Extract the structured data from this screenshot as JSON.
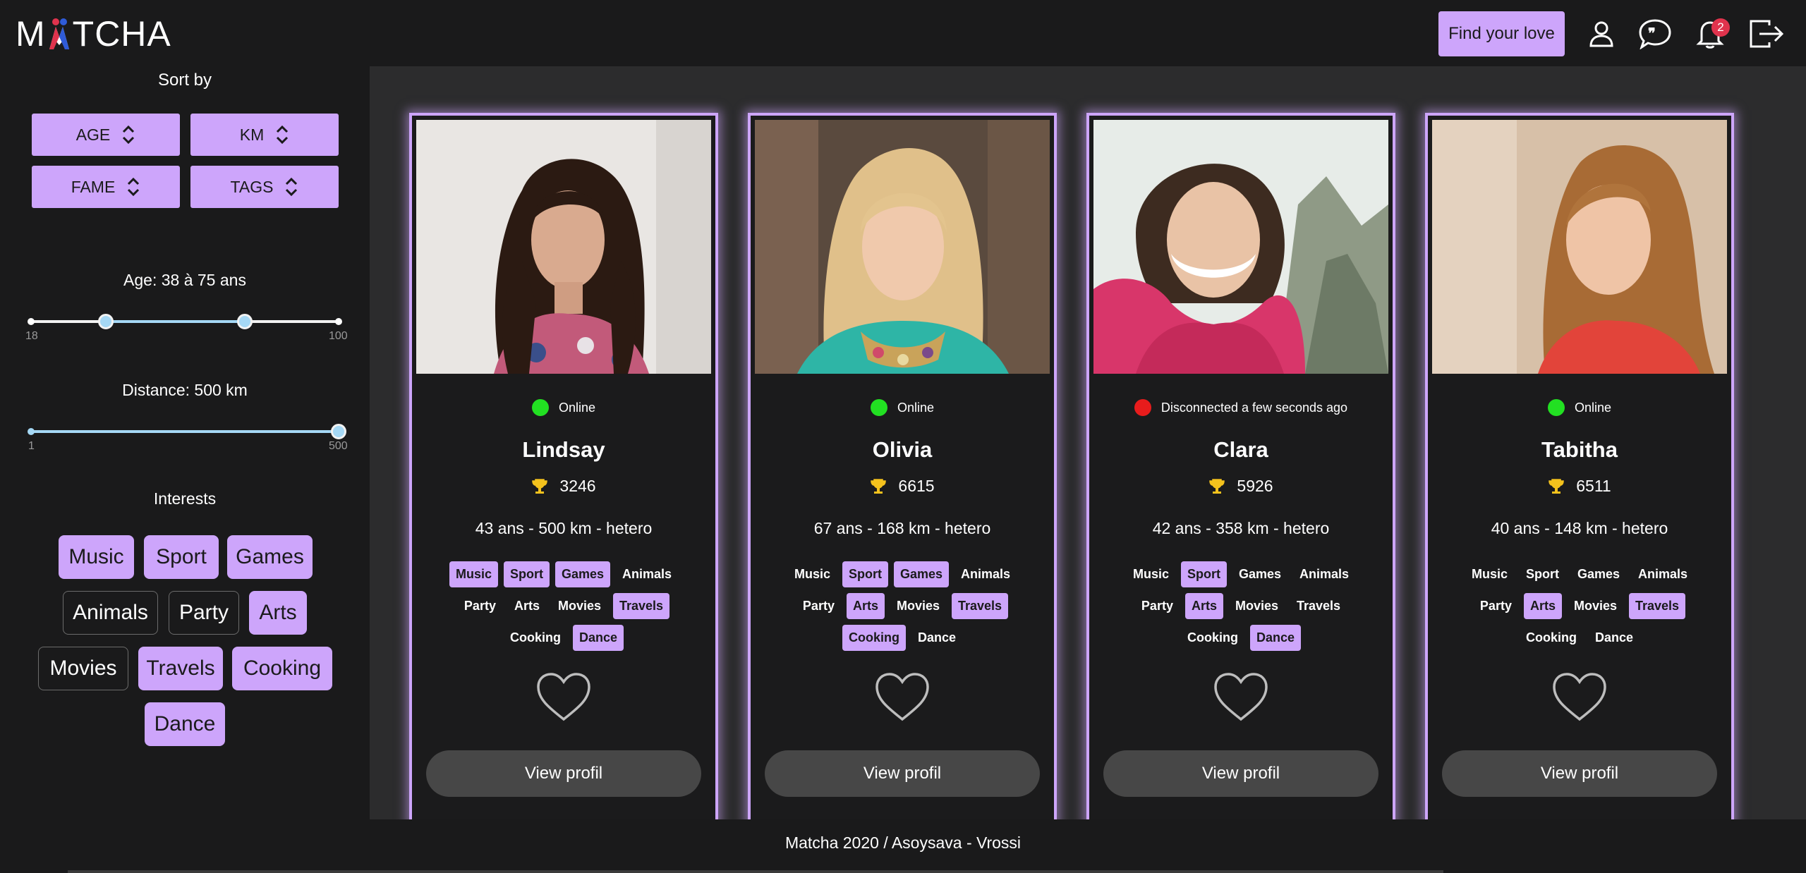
{
  "header": {
    "logo": "MATCHA",
    "find_love_label": "Find your love",
    "notification_count": "2",
    "icons": [
      "user-icon",
      "chat-icon",
      "bell-icon",
      "logout-icon"
    ]
  },
  "sidebar": {
    "sort_title": "Sort by",
    "sort_buttons": [
      "AGE",
      "KM",
      "FAME",
      "TAGS"
    ],
    "age": {
      "label": "Age: 38 à 75 ans",
      "min_label": "18",
      "max_label": "100",
      "min": 18,
      "max": 100,
      "low": 38,
      "high": 75
    },
    "distance": {
      "label": "Distance: 500 km",
      "min_label": "1",
      "max_label": "500",
      "min": 1,
      "max": 500,
      "value": 500
    },
    "interests_title": "Interests",
    "interests": [
      {
        "label": "Music",
        "selected": true
      },
      {
        "label": "Sport",
        "selected": true
      },
      {
        "label": "Games",
        "selected": true
      },
      {
        "label": "Animals",
        "selected": false
      },
      {
        "label": "Party",
        "selected": false
      },
      {
        "label": "Arts",
        "selected": true
      },
      {
        "label": "Movies",
        "selected": false
      },
      {
        "label": "Travels",
        "selected": true
      },
      {
        "label": "Cooking",
        "selected": true
      },
      {
        "label": "Dance",
        "selected": true
      }
    ]
  },
  "cards": [
    {
      "status": "Online",
      "online": true,
      "name": "Lindsay",
      "fame": "3246",
      "meta": "43 ans - 500 km - hetero",
      "tags": [
        [
          "Music",
          true
        ],
        [
          "Sport",
          true
        ],
        [
          "Games",
          true
        ],
        [
          "Animals",
          false
        ],
        [
          "Party",
          false
        ],
        [
          "Arts",
          false
        ],
        [
          "Movies",
          false
        ],
        [
          "Travels",
          true
        ],
        [
          "Cooking",
          false
        ],
        [
          "Dance",
          true
        ]
      ],
      "view_label": "View profil"
    },
    {
      "status": "Online",
      "online": true,
      "name": "Olivia",
      "fame": "6615",
      "meta": "67 ans - 168 km - hetero",
      "tags": [
        [
          "Music",
          false
        ],
        [
          "Sport",
          true
        ],
        [
          "Games",
          true
        ],
        [
          "Animals",
          false
        ],
        [
          "Party",
          false
        ],
        [
          "Arts",
          true
        ],
        [
          "Movies",
          false
        ],
        [
          "Travels",
          true
        ],
        [
          "Cooking",
          true
        ],
        [
          "Dance",
          false
        ]
      ],
      "view_label": "View profil"
    },
    {
      "status": "Disconnected a few seconds ago",
      "online": false,
      "name": "Clara",
      "fame": "5926",
      "meta": "42 ans - 358 km - hetero",
      "tags": [
        [
          "Music",
          false
        ],
        [
          "Sport",
          true
        ],
        [
          "Games",
          false
        ],
        [
          "Animals",
          false
        ],
        [
          "Party",
          false
        ],
        [
          "Arts",
          true
        ],
        [
          "Movies",
          false
        ],
        [
          "Travels",
          false
        ],
        [
          "Cooking",
          false
        ],
        [
          "Dance",
          true
        ]
      ],
      "view_label": "View profil"
    },
    {
      "status": "Online",
      "online": true,
      "name": "Tabitha",
      "fame": "6511",
      "meta": "40 ans - 148 km - hetero",
      "tags": [
        [
          "Music",
          false
        ],
        [
          "Sport",
          false
        ],
        [
          "Games",
          false
        ],
        [
          "Animals",
          false
        ],
        [
          "Party",
          false
        ],
        [
          "Arts",
          true
        ],
        [
          "Movies",
          false
        ],
        [
          "Travels",
          true
        ],
        [
          "Cooking",
          false
        ],
        [
          "Dance",
          false
        ]
      ],
      "view_label": "View profil"
    }
  ],
  "footer": {
    "text": "Matcha 2020 / Asoysava - Vrossi"
  },
  "colors": {
    "accent": "#cda5fb",
    "online": "#22e022",
    "offline": "#e81c1c",
    "background": "#1a1a1b",
    "panel": "#2c2c2d"
  }
}
